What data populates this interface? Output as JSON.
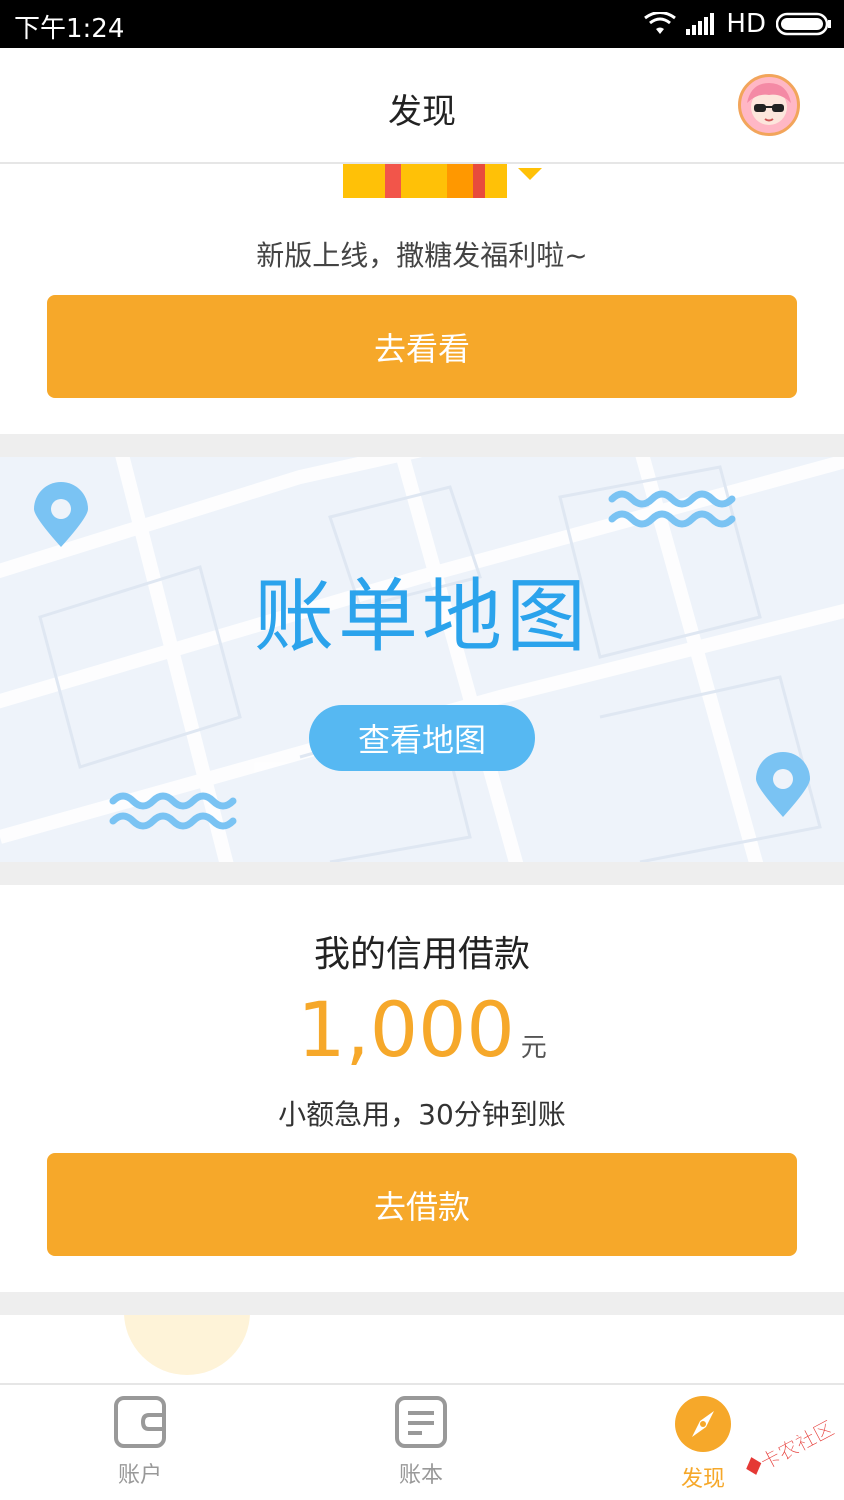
{
  "status_bar": {
    "time": "下午1:24",
    "network": "HD",
    "icons": [
      "wifi-icon",
      "signal-icon",
      "battery-icon"
    ]
  },
  "header": {
    "title": "发现",
    "avatar_icon": "avatar-girl-sunglasses"
  },
  "promo": {
    "text": "新版上线，撒糖发福利啦~",
    "button_label": "去看看"
  },
  "map_banner": {
    "title": "账单地图",
    "button_label": "查看地图",
    "icons": [
      "location-pin-icon",
      "wave-icon"
    ]
  },
  "loan": {
    "title": "我的信用借款",
    "amount": "1,000",
    "unit": "元",
    "subtitle": "小额急用，30分钟到账",
    "button_label": "去借款"
  },
  "tabbar": {
    "items": [
      {
        "label": "账户",
        "icon": "wallet-icon",
        "active": false
      },
      {
        "label": "账本",
        "icon": "ledger-icon",
        "active": false
      },
      {
        "label": "发现",
        "icon": "compass-icon",
        "active": true
      }
    ]
  },
  "colors": {
    "accent": "#f6a82a",
    "map_blue": "#2ba3ec",
    "map_button": "#56b8f2",
    "divider": "#eeeeee"
  },
  "watermark": {
    "text": "卡农社区"
  }
}
